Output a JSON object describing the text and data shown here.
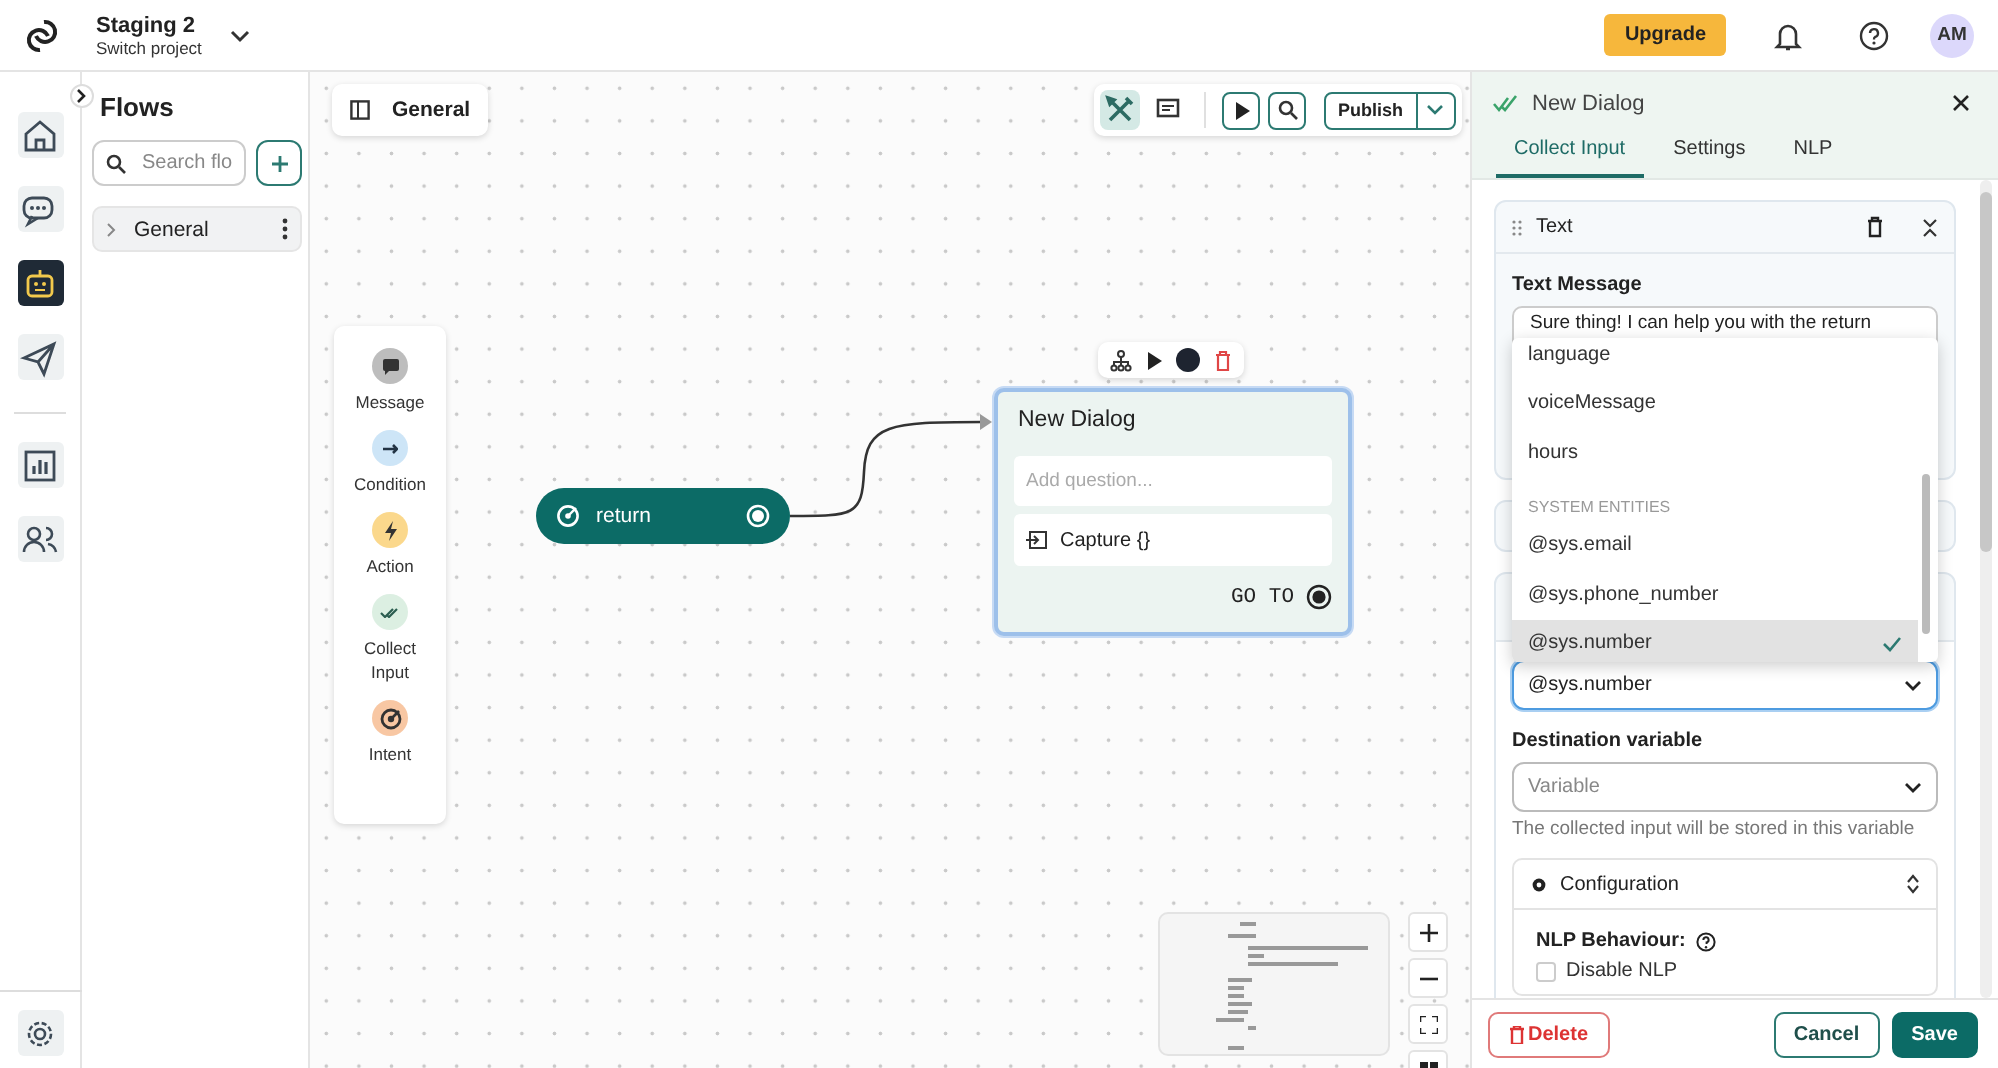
{
  "topbar": {
    "project": "Staging 2",
    "subtitle": "Switch project",
    "upgrade": "Upgrade",
    "avatar": "AM"
  },
  "rail": [
    {
      "selected": false
    },
    {
      "selected": false
    },
    {
      "selected": true
    },
    {
      "selected": false
    },
    {
      "selected": false
    },
    {
      "selected": false
    }
  ],
  "flows": {
    "title": "Flows",
    "search_placeholder": "Search flo",
    "items": [
      {
        "label": "General",
        "expanded": false
      }
    ]
  },
  "canvas": {
    "breadcrumb": "General",
    "modes": [
      {
        "selected": true
      },
      {
        "selected": false
      }
    ],
    "publish": "Publish",
    "palette": [
      {
        "kind": "message",
        "label": "Message"
      },
      {
        "kind": "condition",
        "label": "Condition"
      },
      {
        "kind": "action",
        "label": "Action"
      },
      {
        "kind": "collect",
        "label": "Collect Input"
      },
      {
        "kind": "intent",
        "label": "Intent"
      }
    ],
    "trigger": {
      "label": "return"
    },
    "dialog": {
      "title": "New Dialog",
      "placeholder": "Add question...",
      "capture": "Capture {}",
      "goto": "GO TO"
    }
  },
  "panel": {
    "title": "New Dialog",
    "tabs": [
      {
        "label": "Collect Input",
        "selected": true
      },
      {
        "label": "Settings",
        "selected": false
      },
      {
        "label": "NLP",
        "selected": false
      }
    ],
    "block_title": "Text",
    "text_label": "Text Message",
    "text_value": "Sure thing! I can help you with the return",
    "dropdown": [
      {
        "kind": "option",
        "label": "language",
        "selected": false
      },
      {
        "kind": "option",
        "label": "voiceMessage",
        "selected": false
      },
      {
        "kind": "option",
        "label": "hours",
        "selected": false
      },
      {
        "kind": "header",
        "label": "SYSTEM ENTITIES"
      },
      {
        "kind": "option",
        "label": "@sys.email",
        "selected": false
      },
      {
        "kind": "option",
        "label": "@sys.phone_number",
        "selected": false
      },
      {
        "kind": "option",
        "label": "@sys.number",
        "selected": true
      }
    ],
    "entity_value": "@sys.number",
    "destination_label": "Destination variable",
    "destination_placeholder": "Variable",
    "destination_hint": "The collected input will be stored in this variable",
    "config_title": "Configuration",
    "nlp_label": "NLP Behaviour:",
    "disable_nlp": {
      "label": "Disable NLP",
      "checked": false
    },
    "buttons": {
      "delete": "Delete",
      "cancel": "Cancel",
      "save": "Save"
    }
  }
}
